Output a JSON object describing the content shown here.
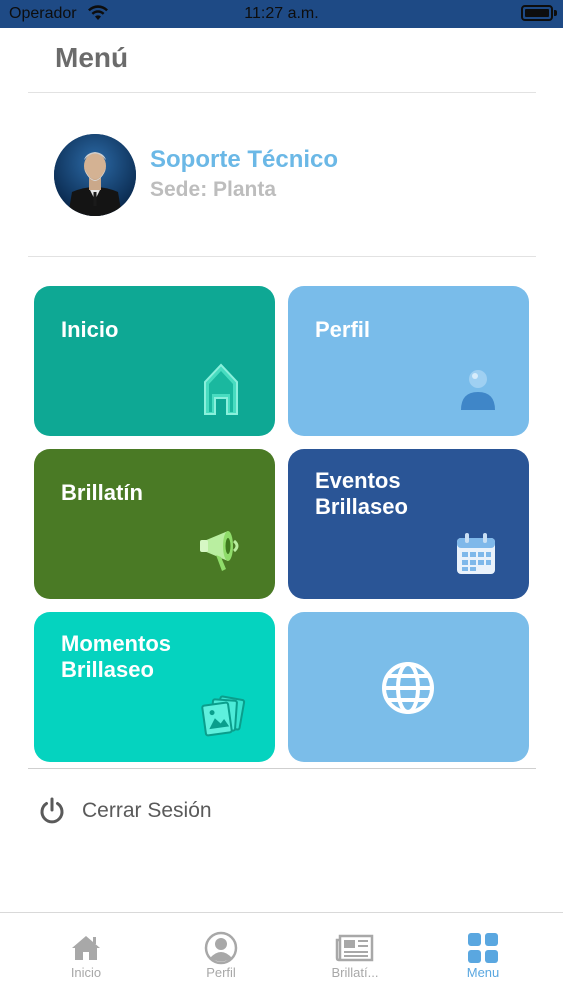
{
  "status_bar": {
    "carrier": "Operador",
    "time": "11:27 a.m."
  },
  "header": {
    "title": "Menú"
  },
  "profile": {
    "name": "Soporte Técnico",
    "sede": "Sede: Planta"
  },
  "tiles": [
    {
      "label": "Inicio",
      "icon": "house-icon",
      "color": "#0ea894"
    },
    {
      "label": "Perfil",
      "icon": "person-icon",
      "color": "#79bcea"
    },
    {
      "label": "Brillatín",
      "icon": "megaphone-icon",
      "color": "#4a7a25"
    },
    {
      "label": "Eventos\nBrillaseo",
      "line1": "Eventos",
      "line2": "Brillaseo",
      "icon": "calendar-icon",
      "color": "#2a5596"
    },
    {
      "label": "Momentos\nBrillaseo",
      "line1": "Momentos",
      "line2": "Brillaseo",
      "icon": "photos-icon",
      "color": "#05d3bf"
    },
    {
      "label": "",
      "icon": "globe-icon",
      "color": "#7bbde9"
    }
  ],
  "logout": {
    "label": "Cerrar Sesión",
    "icon": "power-icon"
  },
  "tab_bar": {
    "tabs": [
      {
        "label": "Inicio",
        "icon": "house-icon",
        "active": false
      },
      {
        "label": "Perfil",
        "icon": "user-circle-icon",
        "active": false
      },
      {
        "label": "Brillatí...",
        "icon": "newspaper-icon",
        "active": false
      },
      {
        "label": "Menu",
        "icon": "grid-icon",
        "active": true
      }
    ],
    "active_color": "#5aa7e0",
    "inactive_color": "#a8a8a8"
  }
}
